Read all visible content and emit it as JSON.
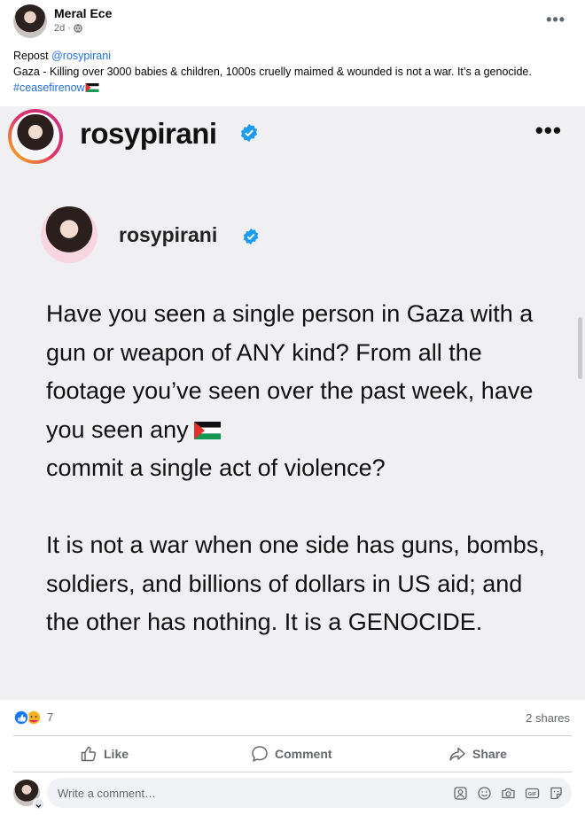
{
  "post": {
    "author": "Meral Ece",
    "time": "2d ·",
    "caption": {
      "repost_prefix": "Repost ",
      "repost_handle": "@rosypirani",
      "body": "Gaza - Killing over 3000 babies & children, 1000s cruelly maimed & wounded is not a war. It’s a genocide. ",
      "hashtag": "#ceasefirenow"
    }
  },
  "shared_image": {
    "outer_username": "rosypirani",
    "inner_username": "rosypirani",
    "paragraph_1_before_flag": "Have you seen a single person in Gaza with a gun or weapon of ANY kind? From all the footage you’ve seen over the past week, have you seen any",
    "paragraph_1_after_flag": "commit a single act of violence?",
    "paragraph_2": "It is not a war when one side has guns, bombs, soldiers, and billions of dollars in US aid; and the other has nothing. It is a GENOCIDE."
  },
  "stats": {
    "reactions_count": "7",
    "shares": "2 shares"
  },
  "actions": {
    "like": "Like",
    "comment": "Comment",
    "share": "Share"
  },
  "comment_box": {
    "placeholder": "Write a comment…"
  },
  "icons": {
    "globe": "globe-icon",
    "verified": "verified-badge-icon",
    "flag": "palestine-flag-icon",
    "like_reaction": "like-reaction-icon",
    "care_reaction": "care-reaction-icon",
    "like": "thumbs-up-icon",
    "comment": "speech-bubble-icon",
    "share": "share-arrow-icon",
    "avatar_sticker": "avatar-sticker-icon",
    "emoji": "emoji-icon",
    "camera": "camera-icon",
    "gif": "gif-icon",
    "sticker": "sticker-icon"
  },
  "colors": {
    "link": "#216fdb",
    "verified": "#1d9bf0",
    "muted": "#65676b",
    "image_bg": "#f0f0f2"
  }
}
